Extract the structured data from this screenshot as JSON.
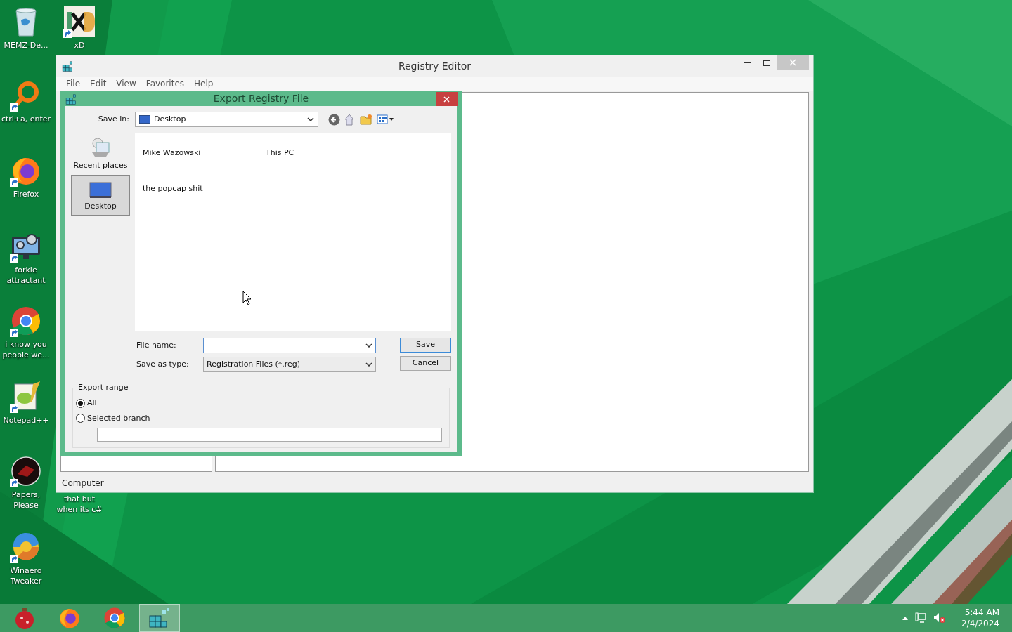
{
  "desktop_icons": [
    {
      "kind": "bin",
      "label": "MEMZ-De..."
    },
    {
      "kind": "xd",
      "label": "xD"
    },
    {
      "kind": "magnifier",
      "label": "ctrl+a, enter"
    },
    {
      "kind": "firefox",
      "label": "Firefox"
    },
    {
      "kind": "monitor",
      "label": "forkie attractant"
    },
    {
      "kind": "chrome",
      "label": "i know you people we..."
    },
    {
      "kind": "notepad",
      "label": "Notepad++"
    },
    {
      "kind": "papers",
      "label": "Papers, Please"
    },
    {
      "kind": "covered",
      "label": "that but when its c#"
    },
    {
      "kind": "winaero",
      "label": "Winaero Tweaker"
    }
  ],
  "registry_window": {
    "title": "Registry Editor",
    "menu": [
      "File",
      "Edit",
      "View",
      "Favorites",
      "Help"
    ],
    "status_bar": "Computer"
  },
  "dialog": {
    "title": "Export Registry File",
    "save_in": {
      "label": "Save in:",
      "value": "Desktop"
    },
    "places": [
      {
        "kind": "recent",
        "label": "Recent places",
        "selected": false
      },
      {
        "kind": "desktop",
        "label": "Desktop",
        "selected": true
      }
    ],
    "files": [
      "Mike Wazowski",
      "This PC",
      "the popcap shit"
    ],
    "file_name": {
      "label": "File name:"
    },
    "save_as_type": {
      "label": "Save as type:",
      "value": "Registration Files (*.reg)"
    },
    "buttons": [
      {
        "label": "Save",
        "selected": true
      },
      {
        "label": "Cancel",
        "selected": false
      }
    ],
    "export_range": {
      "title": "Export range",
      "options": [
        {
          "label": "All",
          "selected": true
        },
        {
          "label": "Selected branch",
          "selected": false
        }
      ]
    }
  },
  "taskbar": {
    "items": [
      {
        "kind": "ornament",
        "selected": false
      },
      {
        "kind": "firefox",
        "selected": false
      },
      {
        "kind": "chrome",
        "selected": false
      },
      {
        "kind": "regedit",
        "selected": true
      }
    ],
    "time": "5:44 AM",
    "date": "2/4/2024"
  }
}
